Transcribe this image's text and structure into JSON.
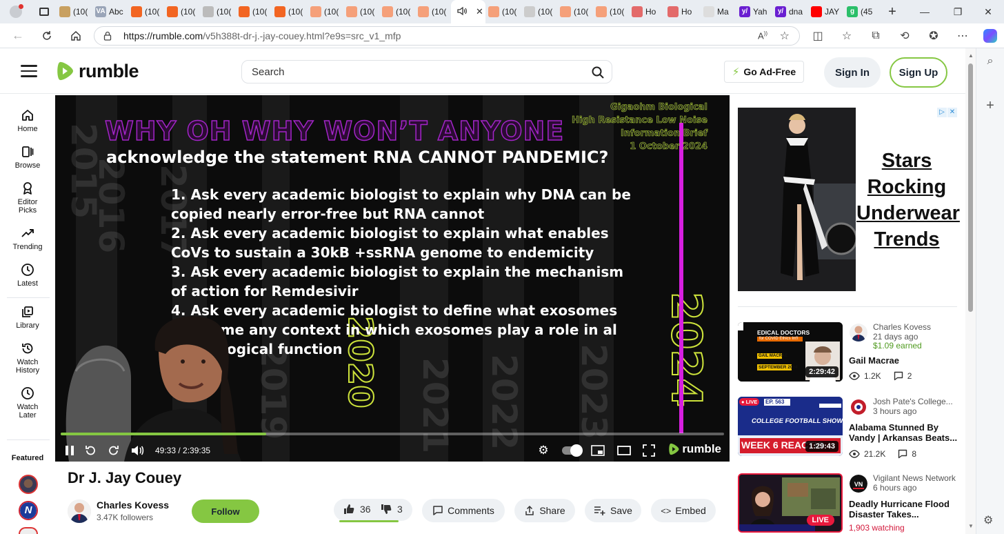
{
  "browser": {
    "tabs": [
      {
        "label": "(10(",
        "color": "#c8a060"
      },
      {
        "label": "Abc",
        "color": "#9aa5b8",
        "fav_text": "VA"
      },
      {
        "label": "(10(",
        "color": "#f26522"
      },
      {
        "label": "(10(",
        "color": "#f26522"
      },
      {
        "label": "(10(",
        "color": "#bbbbbb"
      },
      {
        "label": "(10(",
        "color": "#f26522"
      },
      {
        "label": "(10(",
        "color": "#f26522"
      },
      {
        "label": "(10(",
        "color": "#f5a07a"
      },
      {
        "label": "(10(",
        "color": "#f5a07a"
      },
      {
        "label": "(10(",
        "color": "#f5a07a"
      },
      {
        "label": "(10(",
        "color": "#f5a07a"
      }
    ],
    "tabs_after": [
      {
        "label": "(10(",
        "color": "#f5a07a"
      },
      {
        "label": "(10(",
        "color": "#cccccc"
      },
      {
        "label": "(10(",
        "color": "#f5a07a"
      },
      {
        "label": "(10(",
        "color": "#f5a07a"
      },
      {
        "label": "Ho",
        "color": "#e36a6a"
      },
      {
        "label": "Ho",
        "color": "#e36a6a"
      },
      {
        "label": "Ma",
        "color": "#dddddd"
      },
      {
        "label": "Yah",
        "color": "#6a1fd1",
        "fav_text": "y/"
      },
      {
        "label": "dna",
        "color": "#6a1fd1",
        "fav_text": "y/"
      },
      {
        "label": "JAY",
        "color": "#ff0000"
      },
      {
        "label": "(45",
        "color": "#2bbf6a",
        "fav_text": "g"
      }
    ],
    "url_host": "https://rumble.com",
    "url_path": "/v5h388t-dr-j.-jay-couey.html?e9s=src_v1_mfp"
  },
  "header": {
    "logo_text": "rumble",
    "search_placeholder": "Search",
    "go_ad_free": "Go Ad-Free",
    "sign_in": "Sign In",
    "sign_up": "Sign Up"
  },
  "nav": {
    "items": [
      {
        "label": "Home",
        "icon": "home-icon"
      },
      {
        "label": "Browse",
        "icon": "browse-icon"
      },
      {
        "label": "Editor Picks",
        "icon": "editor-picks-icon"
      },
      {
        "label": "Trending",
        "icon": "trending-icon"
      },
      {
        "label": "Latest",
        "icon": "clock-icon"
      },
      {
        "label": "Library",
        "icon": "library-icon"
      },
      {
        "label": "Watch History",
        "icon": "history-icon"
      },
      {
        "label": "Watch Later",
        "icon": "clock-icon"
      }
    ],
    "featured_label": "Featured"
  },
  "video": {
    "slide": {
      "title_line1": "WHY OH WHY WON’T ANYONE",
      "title_line2": "acknowledge the statement RNA CANNOT PANDEMIC?",
      "brief_lines": [
        "Gigaohm Biological",
        "High Resistance Low Noise",
        "Information Brief",
        "1 October 2024"
      ],
      "list": [
        "1.  Ask every academic biologist to explain why DNA can be copied nearly error-free but RNA cannot",
        "2.  Ask every academic biologist to explain what enables CoVs to sustain a 30kB +ssRNA genome to endemicity",
        "3.  Ask every academic biologist to explain the mechanism of action for Remdesivir",
        "4.  Ask every academic biologist to define what exosomes are  name any context in which exosomes play a role in  al physiological function"
      ],
      "year_highlight_1": "2020",
      "year_highlight_2": "2024",
      "ghost_years": [
        "2015",
        "2016",
        "2017",
        "2019",
        "2021",
        "2022",
        "2023"
      ],
      "bg_text": "2020"
    },
    "progress_fraction": 0.31,
    "time_display": "49:33 / 2:39:35",
    "player_logo": "rumble",
    "title": "Dr J. Jay Couey",
    "channel": {
      "name": "Charles Kovess",
      "followers": "3.47K followers",
      "follow_label": "Follow"
    },
    "likes": "36",
    "dislikes": "3",
    "actions": {
      "comments": "Comments",
      "share": "Share",
      "save": "Save",
      "embed": "Embed"
    }
  },
  "ad": {
    "headline": "Stars Rocking Underwear Trends",
    "close_a": "▷",
    "close_b": "✕"
  },
  "recommendations": [
    {
      "channel": "Charles Kovess",
      "meta": "21 days ago",
      "earned": "$1.09 earned",
      "title": "Gail Macrae",
      "views": "1.2K",
      "comments": "2",
      "duration": "2:29:42",
      "thumb_text_1": "EDICAL DOCTORS",
      "thumb_text_2": "for COVID Ethics Int'l",
      "thumb_text_3": "GAIL MACRAE",
      "thumb_text_4": "SEPTEMBER 2024"
    },
    {
      "channel": "Josh Pate's College...",
      "meta": "3 hours ago",
      "title": "Alabama Stunned By Vandy | Arkansas Beats...",
      "views": "21.2K",
      "comments": "8",
      "duration": "1:29:43",
      "thumb_live": "LIVE",
      "thumb_ep": "EP. 563",
      "thumb_show": "COLLEGE FOOTBALL SHOW",
      "thumb_week": "WEEK 6 REACTIO"
    },
    {
      "channel": "Vigilant News Network",
      "meta": "6 hours ago",
      "title": "Deadly Hurricane Flood Disaster Takes...",
      "watching": "1,903 watching",
      "live_badge": "LIVE"
    }
  ],
  "colors": {
    "rumble_green": "#85c742",
    "live_red": "#e8193c",
    "slide_magenta": "#d71fe0",
    "slide_yellow": "#cde33b"
  }
}
